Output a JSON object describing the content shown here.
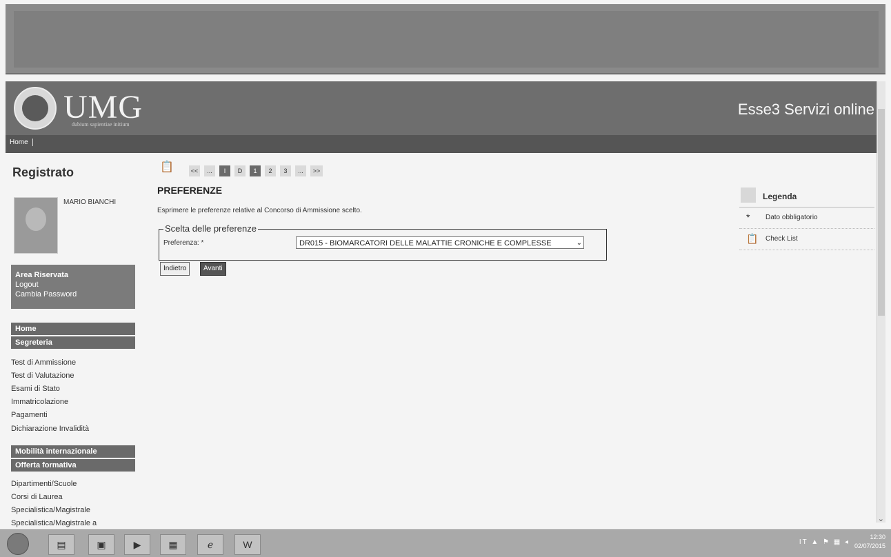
{
  "header": {
    "logo_text": "UMG",
    "logo_motto": "dubium sapientiae initium",
    "service_title": "Esse3 Servizi online"
  },
  "nav": {
    "home": "Home"
  },
  "sidebar": {
    "title": "Registrato",
    "user_name": "MARIO BIANCHI",
    "area": {
      "title": "Area Riservata",
      "logout": "Logout",
      "change_password": "Cambia Password"
    },
    "sections": [
      {
        "label": "Home"
      },
      {
        "label": "Segreteria"
      }
    ],
    "segreteria_items": [
      "Test di Ammissione",
      "Test di Valutazione",
      "Esami di Stato",
      "Immatricolazione",
      "Pagamenti",
      "Dichiarazione Invalidità"
    ],
    "mobility": "Mobilità internazionale",
    "offerta": "Offerta formativa",
    "offerta_items": [
      "Dipartimenti/Scuole",
      "Corsi di Laurea",
      "Specialistica/Magistrale",
      "Specialistica/Magistrale a"
    ]
  },
  "pager": [
    "<<",
    "...",
    "I",
    "D",
    "1",
    "2",
    "3",
    "...",
    ">>"
  ],
  "main": {
    "title": "PREFERENZE",
    "description": "Esprimere le preferenze relative al Concorso di Ammissione scelto.",
    "fieldset_legend": "Scelta delle preferenze",
    "field_label": "Preferenza: *",
    "field_value": "DR015 - BIOMARCATORI DELLE MALATTIE CRONICHE E COMPLESSE",
    "btn_back": "Indietro",
    "btn_next": "Avanti"
  },
  "legenda": {
    "title": "Legenda",
    "items": [
      {
        "symbol": "*",
        "label": "Dato obbligatorio"
      },
      {
        "symbol": "📋",
        "label": "Check List"
      }
    ]
  },
  "taskbar": {
    "tray_text": "IT  ▲ ⚑ ▦ ◂",
    "time": "12:30",
    "date": "02/07/2015"
  }
}
